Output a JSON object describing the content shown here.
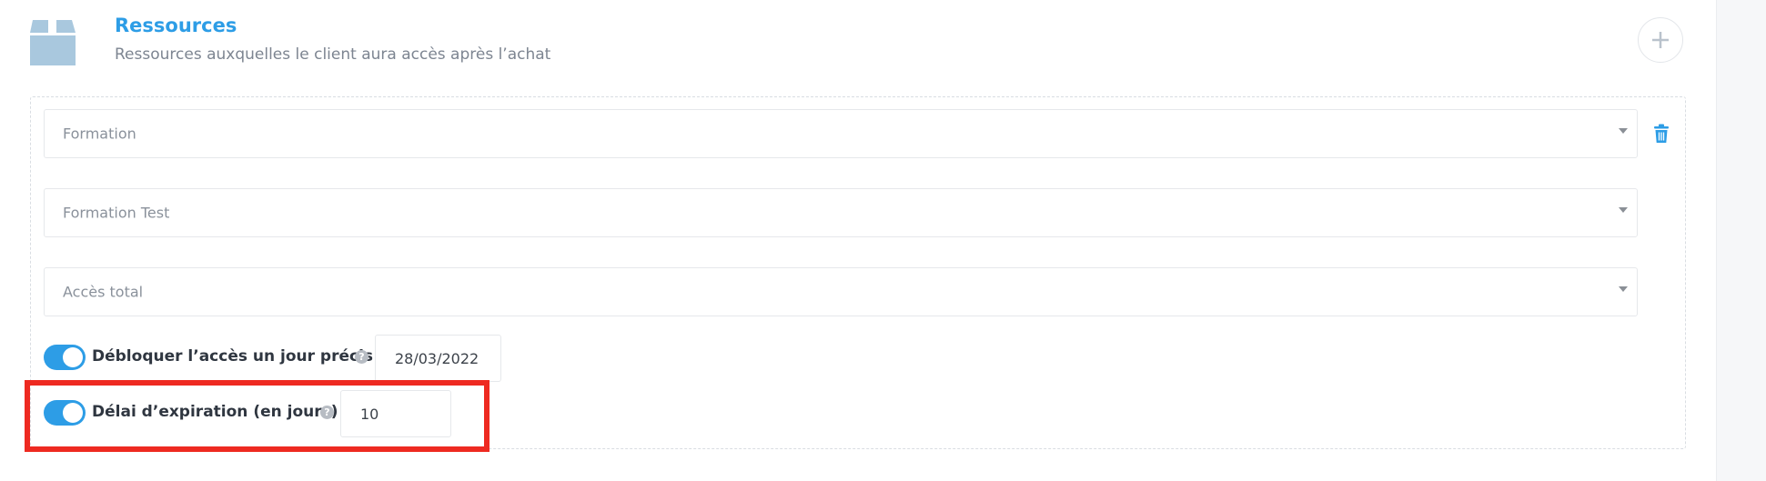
{
  "section": {
    "title": "Ressources",
    "subtitle": "Ressources auxquelles le client aura accès après l’achat",
    "icon": "box-icon",
    "add_icon": "plus-icon"
  },
  "resource": {
    "selects": [
      {
        "value": "Formation"
      },
      {
        "value": "Formation Test"
      },
      {
        "value": "Accès total"
      }
    ],
    "delete_icon": "trash-icon",
    "unlock_option": {
      "label": "Débloquer l’accès un jour précis",
      "enabled": true,
      "date": "28/03/2022",
      "help": "?"
    },
    "expiration_option": {
      "label": "Délai d’expiration (en jours)",
      "enabled": true,
      "days": "10",
      "help": "?"
    }
  },
  "colors": {
    "accent": "#2d9de6",
    "highlight": "#ee2a21",
    "icon_box": "#a9c8de"
  }
}
